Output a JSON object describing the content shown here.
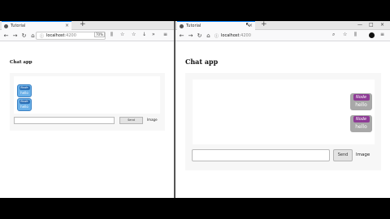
{
  "left_window": {
    "tab_title": "Tutorial",
    "url_host": "localhost",
    "url_port": ":4200",
    "zoom": "70%",
    "app_title": "Chat app",
    "messages": [
      {
        "name": "Node",
        "text": "hello"
      },
      {
        "name": "Node",
        "text": "hello"
      }
    ],
    "send_label": "Send",
    "image_label": "Image"
  },
  "right_window": {
    "tab_title": "Tutorial",
    "url_host": "localhost",
    "url_port": ":4200",
    "app_title": "Chat app",
    "messages": [
      {
        "name": "Node",
        "text": "hello"
      },
      {
        "name": "Node",
        "text": "hello"
      }
    ],
    "send_label": "Send",
    "image_label": "Image"
  },
  "icons": {
    "back": "←",
    "forward": "→",
    "reload": "↻",
    "home": "⌂",
    "info": "ⓘ",
    "bookmark": "☆",
    "library": "⫼",
    "download": "↓",
    "overflow": "»",
    "menu": "≡",
    "new_tab": "+",
    "close": "×",
    "minimize": "—",
    "maximize": "□"
  }
}
